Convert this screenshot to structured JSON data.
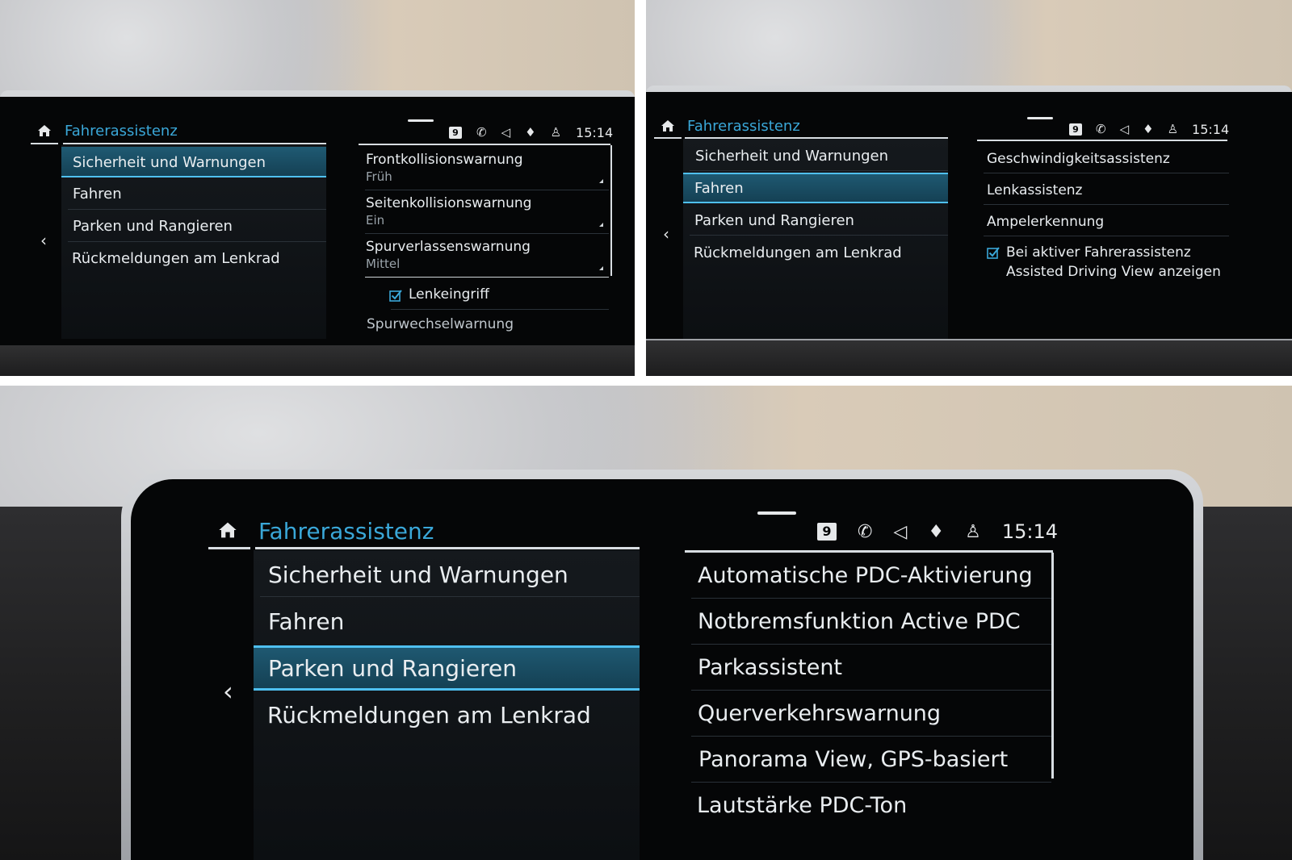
{
  "panels": {
    "top_left": {
      "title": "Fahrerassistenz",
      "time": "15:14",
      "badge": "9",
      "menu": [
        "Sicherheit und Warnungen",
        "Fahren",
        "Parken und Rangieren",
        "Rückmeldungen am Lenkrad"
      ],
      "selected_index": 0,
      "right_items": [
        {
          "label": "Frontkollisionswarnung",
          "value": "Früh"
        },
        {
          "label": "Seitenkollisionswarnung",
          "value": "Ein"
        },
        {
          "label": "Spurverlassenswarnung",
          "value": "Mittel"
        }
      ],
      "checkbox_item": "Lenkeingriff",
      "checkbox_checked": true,
      "last_item": "Spurwechselwarnung"
    },
    "top_right": {
      "title": "Fahrerassistenz",
      "time": "15:14",
      "badge": "9",
      "menu": [
        "Sicherheit und Warnungen",
        "Fahren",
        "Parken und Rangieren",
        "Rückmeldungen am Lenkrad"
      ],
      "selected_index": 1,
      "right_items": [
        "Geschwindigkeitsassistenz",
        "Lenkassistenz",
        "Ampelerkennung"
      ],
      "checkbox_line1": "Bei aktiver Fahrerassistenz",
      "checkbox_line2": "Assisted Driving View anzeigen",
      "checkbox_checked": true
    },
    "bottom": {
      "title": "Fahrerassistenz",
      "time": "15:14",
      "badge": "9",
      "menu": [
        "Sicherheit und Warnungen",
        "Fahren",
        "Parken und Rangieren",
        "Rückmeldungen am Lenkrad"
      ],
      "selected_index": 2,
      "right_items": [
        "Automatische PDC-Aktivierung",
        "Notbremsfunktion Active PDC",
        "Parkassistent",
        "Querverkehrswarnung",
        "Panorama View, GPS-basiert",
        "Lautstärke PDC-Ton"
      ]
    }
  },
  "icons": [
    "home-icon",
    "back-chevron-icon",
    "phone-icon",
    "speaker-icon",
    "microphone-icon",
    "profile-icon",
    "checkbox-icon"
  ],
  "colors": {
    "accent": "#3aa7d8",
    "selection": "#1f5a73",
    "screen": "#050607"
  }
}
